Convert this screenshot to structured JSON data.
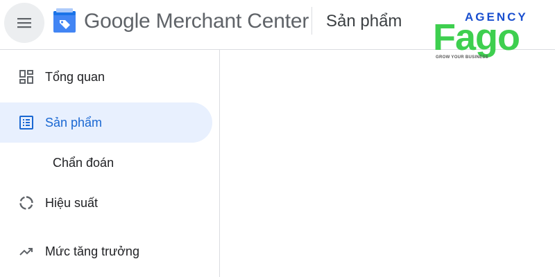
{
  "header": {
    "brand": "Google Merchant Center",
    "section_title": "Sản phẩm"
  },
  "watermark": {
    "top_text": "AGENCY",
    "main_text": "Fago",
    "tagline": "GROW YOUR BUSINESS"
  },
  "sidebar": {
    "items": [
      {
        "label": "Tổng quan",
        "icon": "dashboard-icon",
        "active": false
      },
      {
        "label": "Sản phẩm",
        "icon": "list-icon",
        "active": true
      },
      {
        "label": "Chẩn đoán",
        "icon": "",
        "active": false,
        "sub": true
      },
      {
        "label": "Hiệu suất",
        "icon": "donut-icon",
        "active": false
      },
      {
        "label": "Mức tăng trưởng",
        "icon": "trending-up-icon",
        "active": false
      }
    ]
  },
  "colors": {
    "active_background": "#e8f0fe",
    "active_text": "#1967d2",
    "agency_blue": "#1a4fcf",
    "agency_green": "#3ecf4f"
  }
}
